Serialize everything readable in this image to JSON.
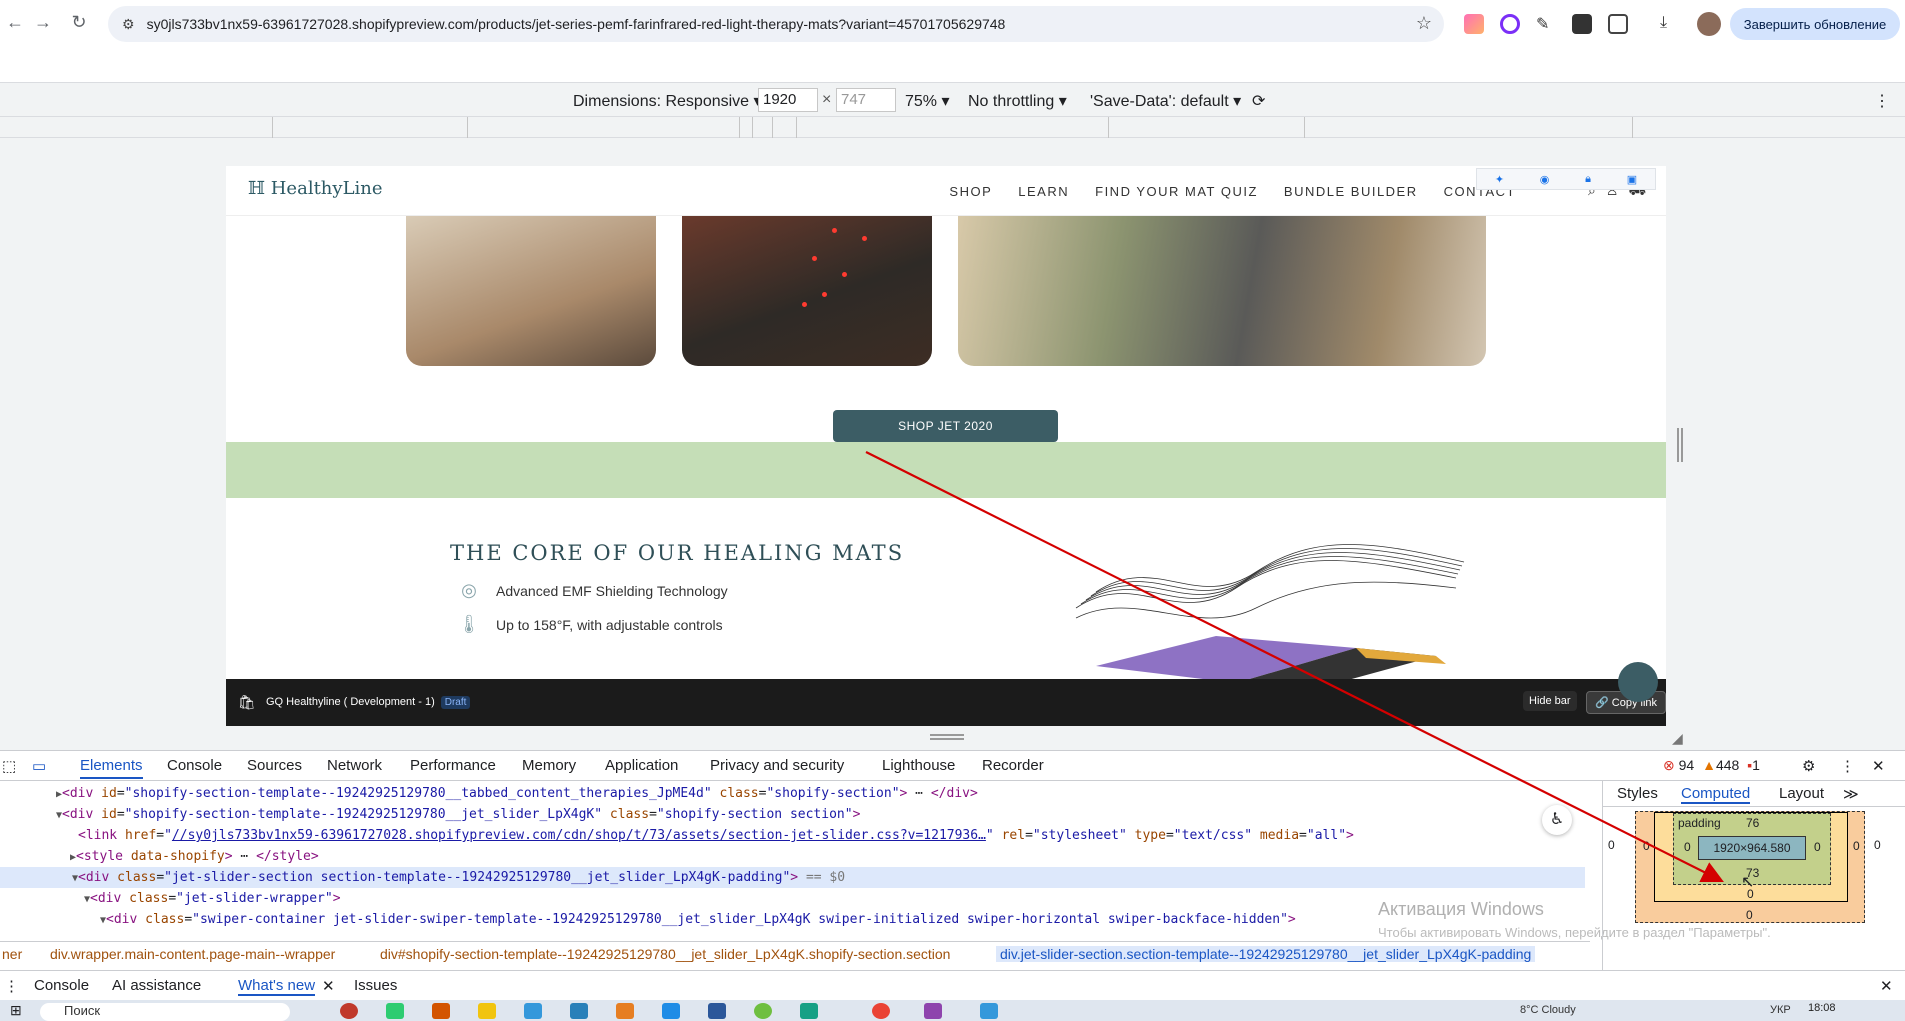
{
  "browser": {
    "url": "sy0jls733bv1nx59-63961727028.shopifypreview.com/products/jet-series-pemf-farinfrared-red-light-therapy-mats?variant=45701705629748",
    "update_button": "Завершить обновление"
  },
  "device_toolbar": {
    "dimensions_label": "Dimensions: Responsive",
    "width": "1920",
    "height": "747",
    "zoom": "75%",
    "throttling": "No throttling",
    "save_data": "'Save-Data': default"
  },
  "site": {
    "logo": "HealthyLine",
    "nav": [
      "SHOP",
      "LEARN",
      "FIND YOUR MAT QUIZ",
      "BUNDLE BUILDER",
      "CONTACT"
    ],
    "shop_button": "SHOP JET 2020",
    "core_title": "THE CORE OF OUR HEALING MATS",
    "features": [
      "Advanced EMF Shielding Technology",
      "Up to 158°F, with adjustable controls"
    ],
    "shopify_bar": {
      "store_name": "GQ Healthyline ( Development - 1)",
      "badge": "Draft",
      "hide_bar": "Hide bar",
      "copy_link": "Copy link"
    }
  },
  "devtools": {
    "tabs": [
      "Elements",
      "Console",
      "Sources",
      "Network",
      "Performance",
      "Memory",
      "Application",
      "Privacy and security",
      "Lighthouse",
      "Recorder"
    ],
    "errors": "94",
    "warnings": "448",
    "issues": "1",
    "code": {
      "line1_id": "shopify-section-template--19242925129780__tabbed_content_therapies_JpME4d",
      "line1_class": "shopify-section",
      "line2_id": "shopify-section-template--19242925129780__jet_slider_LpX4gK",
      "line2_class": "shopify-section section",
      "line3_href": "//sy0jls733bv1nx59-63961727028.shopifypreview.com/cdn/shop/t/73/assets/section-jet-slider.css?v=1217936…",
      "line3_rel": "stylesheet",
      "line3_type": "text/css",
      "line3_media": "all",
      "line4_attr": "data-shopify",
      "line5_class": "jet-slider-section section-template--19242925129780__jet_slider_LpX4gK-padding",
      "line5_suffix": "== $0",
      "line6_class": "jet-slider-wrapper",
      "line7_class": "swiper-container jet-slider-swiper-template--19242925129780__jet_slider_LpX4gK swiper-initialized swiper-horizontal swiper-backface-hidden"
    },
    "breadcrumbs": [
      "ner",
      "div.wrapper.main-content.page-main--wrapper",
      "div#shopify-section-template--19242925129780__jet_slider_LpX4gK.shopify-section.section",
      "div.jet-slider-section.section-template--19242925129780__jet_slider_LpX4gK-padding"
    ],
    "side_tabs": [
      "Styles",
      "Computed",
      "Layout"
    ],
    "box_model": {
      "padding_label": "padding",
      "padding_top": "76",
      "content": "1920×964.580",
      "padding_bottom": "73",
      "zero": "0"
    },
    "watermark": "Активация Windows",
    "watermark_sub": "Чтобы активировать Windows, перейдите в раздел \"Параметры\".",
    "drawer_tabs": [
      "Console",
      "AI assistance",
      "What's new",
      "Issues"
    ]
  },
  "taskbar": {
    "search": "Поиск",
    "weather": "8°C Cloudy",
    "lang": "УКР",
    "time": "18:08"
  },
  "colors": {
    "accent": "#1a56c4",
    "green_band": "#c5deb7",
    "shop_button": "#3c5d65",
    "annotation": "#d40000"
  }
}
